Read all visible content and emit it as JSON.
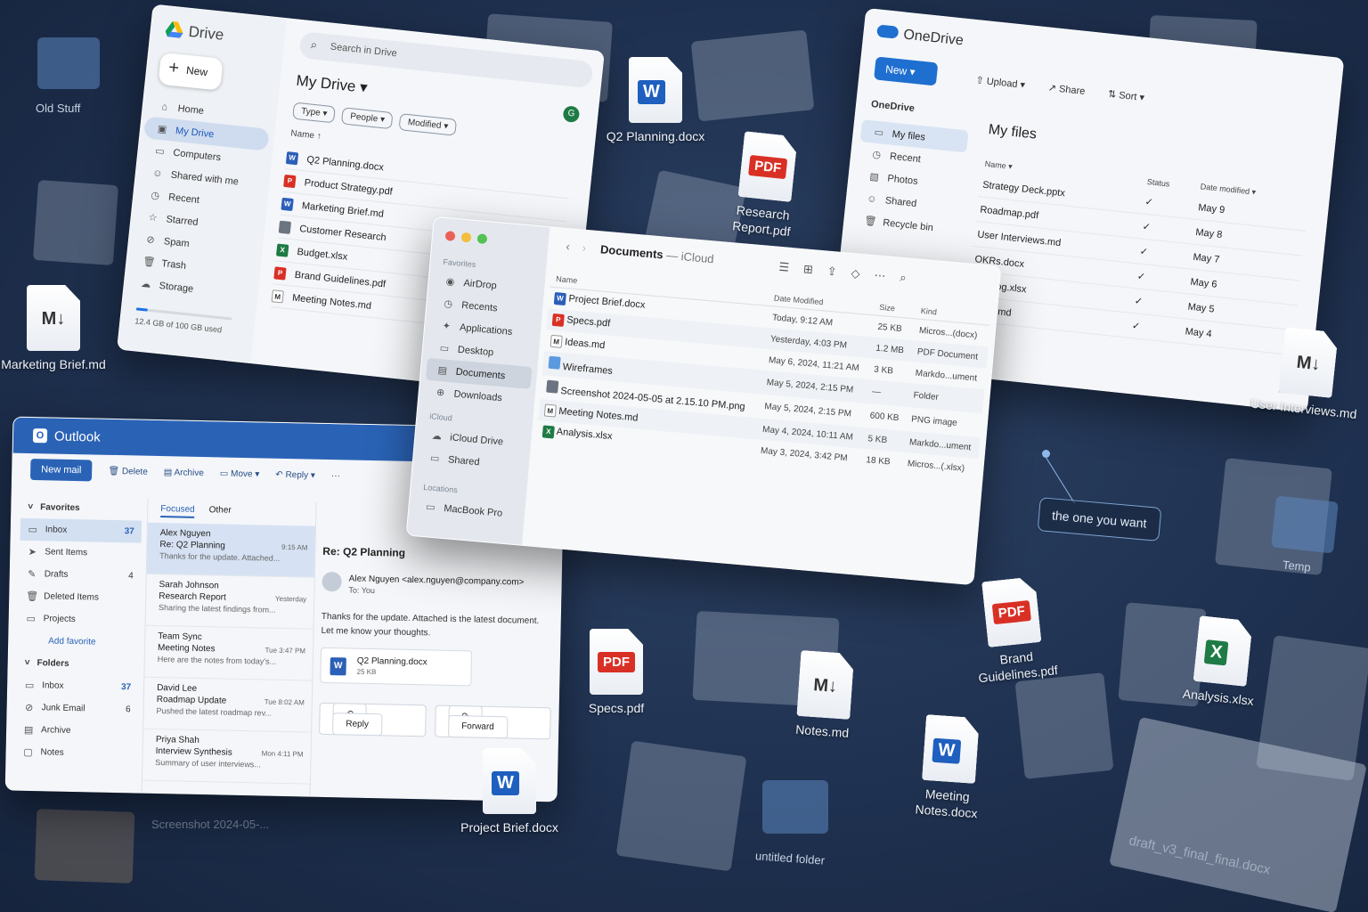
{
  "desktop_icons": {
    "old_stuff": "Old Stuff",
    "marketing_brief": "Marketing Brief.md",
    "q2_planning": "Q2 Planning.docx",
    "q2_planning_badge": "W",
    "research_report": "Research Report.pdf",
    "user_interviews": "User Interviews.md",
    "specs": "Specs.pdf",
    "notes": "Notes.md",
    "brand_guidelines": "Brand Guidelines.pdf",
    "analysis": "Analysis.xlsx",
    "meeting_notes": "Meeting Notes.docx",
    "project_brief": "Project Brief.docx",
    "temp": "Temp",
    "untitled_folder": "untitled folder",
    "screenshot": "Screenshot 2024-05-...",
    "draft": "draft_v3_final_final.docx",
    "badge_pdf": "PDF",
    "badge_word": "W",
    "badge_excel": "X",
    "badge_md": "M↓"
  },
  "drive": {
    "title": "Drive",
    "new_label": "New",
    "search_placeholder": "Search in Drive",
    "heading": "My Drive ▾",
    "filters": [
      "Type ▾",
      "People ▾",
      "Modified ▾"
    ],
    "name_header": "Name ↑",
    "nav": [
      "Home",
      "My Drive",
      "Computers",
      "Shared with me",
      "Recent",
      "Starred",
      "Spam",
      "Trash",
      "Storage"
    ],
    "files": [
      "Q2 Planning.docx",
      "Product Strategy.pdf",
      "Marketing Brief.md",
      "Customer Research",
      "Budget.xlsx",
      "Brand Guidelines.pdf",
      "Meeting Notes.md"
    ],
    "storage_text": "12.4 GB of 100 GB used",
    "storage_fraction": 0.124,
    "avatar": "G"
  },
  "onedrive": {
    "title": "OneDrive",
    "new_label": "New ▾",
    "toolbar": [
      "Upload ▾",
      "Share",
      "Sort ▾"
    ],
    "side_title": "OneDrive",
    "nav": [
      "My files",
      "Recent",
      "Photos",
      "Shared",
      "Recycle bin"
    ],
    "heading": "My files",
    "columns": [
      "Name ▾",
      "Status",
      "Date modified ▾"
    ],
    "rows": [
      {
        "name": "Strategy Deck.pptx",
        "status": "✓",
        "date": "May 9"
      },
      {
        "name": "Roadmap.pdf",
        "status": "✓",
        "date": "May 8"
      },
      {
        "name": "User Interviews.md",
        "status": "✓",
        "date": "May 7"
      },
      {
        "name": "OKRs.docx",
        "status": "✓",
        "date": "May 6"
      },
      {
        "name": "Backlog.xlsx",
        "status": "✓",
        "date": "May 5"
      },
      {
        "name": "Notes.md",
        "status": "✓",
        "date": "May 4"
      }
    ]
  },
  "finder": {
    "title": "Documents",
    "subtitle": "— iCloud",
    "sections": {
      "favorites": "Favorites",
      "icloud": "iCloud",
      "locations": "Locations"
    },
    "favorites": [
      "AirDrop",
      "Recents",
      "Applications",
      "Desktop",
      "Documents",
      "Downloads"
    ],
    "icloud": [
      "iCloud Drive",
      "Shared"
    ],
    "locations": [
      "MacBook Pro"
    ],
    "columns": [
      "Name",
      "Date Modified",
      "Size",
      "Kind"
    ],
    "rows": [
      {
        "name": "Project Brief.docx",
        "date": "Today, 9:12 AM",
        "size": "25 KB",
        "kind": "Micros...(docx)"
      },
      {
        "name": "Specs.pdf",
        "date": "Yesterday, 4:03 PM",
        "size": "1.2 MB",
        "kind": "PDF Document"
      },
      {
        "name": "Ideas.md",
        "date": "May 6, 2024, 11:21 AM",
        "size": "3 KB",
        "kind": "Markdo...ument"
      },
      {
        "name": "Wireframes",
        "date": "May 5, 2024, 2:15 PM",
        "size": "—",
        "kind": "Folder"
      },
      {
        "name": "Screenshot 2024-05-05 at 2.15.10 PM.png",
        "date": "May 5, 2024, 2:15 PM",
        "size": "600 KB",
        "kind": "PNG image"
      },
      {
        "name": "Meeting Notes.md",
        "date": "May 4, 2024, 10:11 AM",
        "size": "5 KB",
        "kind": "Markdo...ument"
      },
      {
        "name": "Analysis.xlsx",
        "date": "May 3, 2024, 3:42 PM",
        "size": "18 KB",
        "kind": "Micros...(.xlsx)"
      }
    ]
  },
  "outlook": {
    "title": "Outlook",
    "new_mail": "New mail",
    "commands": [
      "Delete",
      "Archive",
      "Move ▾",
      "Reply ▾",
      "···"
    ],
    "favorites_head": "Favorites",
    "favorites": [
      {
        "label": "Inbox",
        "count": "37"
      },
      {
        "label": "Sent Items",
        "count": ""
      },
      {
        "label": "Drafts",
        "count": "4"
      },
      {
        "label": "Deleted Items",
        "count": ""
      },
      {
        "label": "Projects",
        "count": ""
      }
    ],
    "add_favorite": "Add favorite",
    "folders_head": "Folders",
    "folders": [
      {
        "label": "Inbox",
        "count": "37"
      },
      {
        "label": "Junk Email",
        "count": "6"
      },
      {
        "label": "Archive",
        "count": ""
      },
      {
        "label": "Notes",
        "count": ""
      }
    ],
    "tabs": [
      "Focused",
      "Other"
    ],
    "messages": [
      {
        "from": "Alex Nguyen",
        "subject": "Re: Q2 Planning",
        "preview": "Thanks for the update. Attached...",
        "time": "9:15 AM"
      },
      {
        "from": "Sarah Johnson",
        "subject": "Research Report",
        "preview": "Sharing the latest findings from...",
        "time": "Yesterday"
      },
      {
        "from": "Team Sync",
        "subject": "Meeting Notes",
        "preview": "Here are the notes from today's...",
        "time": "Tue 3:47 PM"
      },
      {
        "from": "David Lee",
        "subject": "Roadmap Update",
        "preview": "Pushed the latest roadmap rev...",
        "time": "Tue 8:02 AM"
      },
      {
        "from": "Priya Shah",
        "subject": "Interview Synthesis",
        "preview": "Summary of user interviews...",
        "time": "Mon 4:11 PM"
      }
    ],
    "reading": {
      "subject": "Re: Q2 Planning",
      "sender": "Alex Nguyen <alex.nguyen@company.com>",
      "to": "To: You",
      "body": "Thanks for the update. Attached is the latest document. Let me know your thoughts.",
      "attachment_name": "Q2 Planning.docx",
      "attachment_size": "25 KB",
      "reply": "Reply",
      "forward": "Forward"
    }
  },
  "tooltip": "the one you want"
}
